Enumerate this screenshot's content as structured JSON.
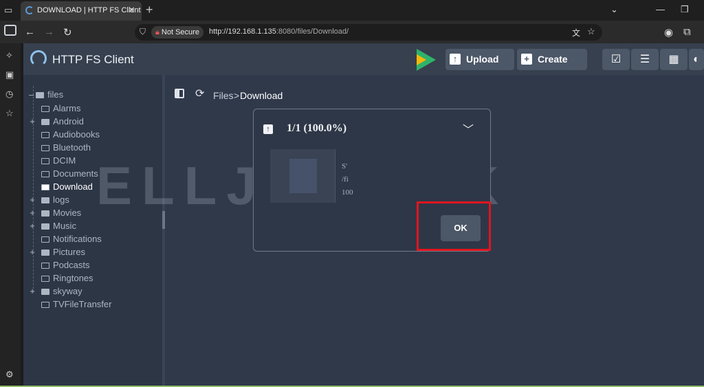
{
  "browser": {
    "tab_title": "DOWNLOAD | HTTP FS Client",
    "security_label": "Not Secure",
    "url_host": "http://192.168.1.135",
    "url_rest": ":8080/files/Download/"
  },
  "app": {
    "title": "HTTP FS Client",
    "upload_label": "Upload",
    "create_label": "Create"
  },
  "tree": {
    "root": "files",
    "items": [
      {
        "label": "Alarms",
        "expandable": false
      },
      {
        "label": "Android",
        "expandable": true
      },
      {
        "label": "Audiobooks",
        "expandable": false
      },
      {
        "label": "Bluetooth",
        "expandable": false
      },
      {
        "label": "DCIM",
        "expandable": false
      },
      {
        "label": "Documents",
        "expandable": false
      },
      {
        "label": "Download",
        "expandable": false,
        "active": true
      },
      {
        "label": "logs",
        "expandable": true
      },
      {
        "label": "Movies",
        "expandable": true
      },
      {
        "label": "Music",
        "expandable": true
      },
      {
        "label": "Notifications",
        "expandable": false
      },
      {
        "label": "Pictures",
        "expandable": true
      },
      {
        "label": "Podcasts",
        "expandable": false
      },
      {
        "label": "Ringtones",
        "expandable": false
      },
      {
        "label": "skyway",
        "expandable": true
      },
      {
        "label": "TVFileTransfer",
        "expandable": false
      }
    ]
  },
  "breadcrumb": {
    "root": "Files",
    "separator": ">",
    "current": "Download"
  },
  "dialog": {
    "title": "1/1 (100.0%)",
    "file_line1": "S'",
    "file_line2": "/fi",
    "file_line3": "100",
    "ok_label": "OK"
  },
  "watermark": "ELLJINO.SK"
}
